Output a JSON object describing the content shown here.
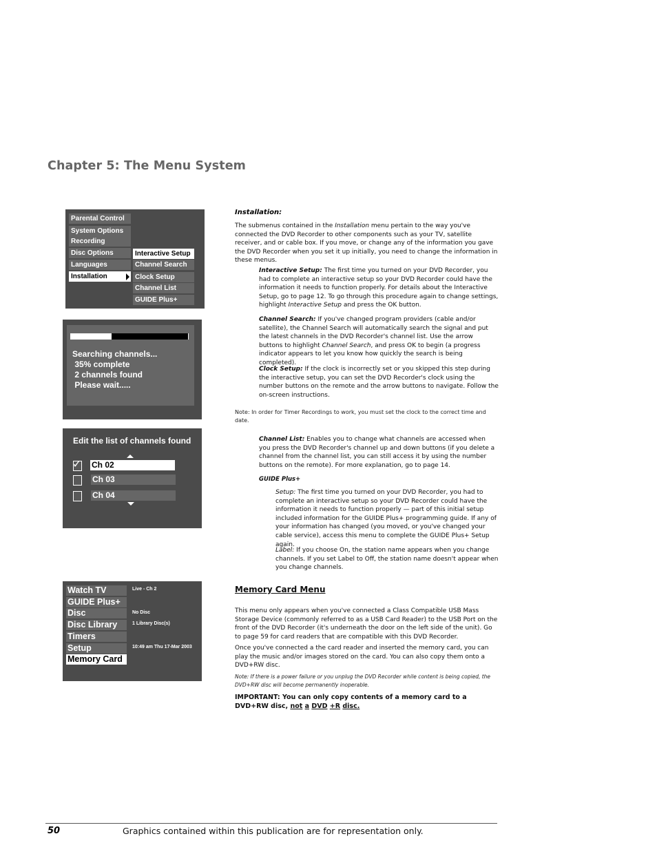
{
  "chapter_title": "Chapter 5: The Menu System",
  "setup_menu_screen": {
    "left_items": [
      {
        "label": "Parental Control",
        "selected": false
      },
      {
        "label": "System Options",
        "selected": false
      },
      {
        "label": "Recording Options",
        "selected": false
      },
      {
        "label": "Disc Options",
        "selected": false
      },
      {
        "label": "Languages",
        "selected": false
      },
      {
        "label": "Installation",
        "selected": true
      }
    ],
    "submenu_items": [
      {
        "label": "Interactive Setup",
        "selected": true
      },
      {
        "label": "Channel Search",
        "selected": false
      },
      {
        "label": "Clock Setup",
        "selected": false
      },
      {
        "label": "Channel List",
        "selected": false
      },
      {
        "label": "GUIDE Plus+",
        "selected": false
      }
    ]
  },
  "search_screen": {
    "progress_percent": 35,
    "lines": [
      "Searching channels...",
      " 35% complete",
      " 2 channels found",
      " Please wait....."
    ]
  },
  "edit_screen": {
    "title": "Edit the list of channels found",
    "channels": [
      {
        "label": "Ch 02",
        "checked": true,
        "selected": true
      },
      {
        "label": "Ch 03",
        "checked": false,
        "selected": false
      },
      {
        "label": "Ch 04",
        "checked": false,
        "selected": false
      }
    ]
  },
  "main_menu_screen": {
    "items": [
      {
        "label": "Watch TV",
        "info": "Live - Ch 2",
        "selected": false
      },
      {
        "label": "GUIDE Plus+",
        "info": "",
        "selected": false
      },
      {
        "label": "Disc",
        "info": "No Disc",
        "selected": false
      },
      {
        "label": "Disc Library",
        "info": "1 Library Disc(s)",
        "selected": false
      },
      {
        "label": "Timers",
        "info": "",
        "selected": false
      },
      {
        "label": "Setup",
        "info": "10:49 am Thu 17-Mar 2003",
        "selected": false
      },
      {
        "label": "Memory Card",
        "info": "",
        "selected": true
      }
    ]
  },
  "content": {
    "installation_heading": "Installation:",
    "installation_intro_a": " The submenus contained in the ",
    "installation_intro_em": "Installation",
    "installation_intro_b": " menu pertain to the way you've connected the DVD Recorder to other components such as your TV, satellite receiver, and or cable box. If you move, or change any of the information you gave the DVD Recorder when you set it up initially, you need to change the information in these menus.",
    "interactive_term": "Interactive Setup:",
    "interactive_a": " The first time you turned on your DVD Recorder, you had to complete an interactive setup so your DVD Recorder could have the information it needs to function properly. For details about the Interactive Setup, go to page 12. To go through this procedure again to change settings, highlight ",
    "interactive_em": "Interactive Setup",
    "interactive_b": " and press the OK button.",
    "search_term": "Channel Search:",
    "search_a": " If you've changed program providers (cable and/or satellite), the Channel Search will automatically search the signal and put the latest channels in the DVD Recorder's channel list. Use the arrow buttons to highlight ",
    "search_em": "Channel Search",
    "search_b": ", and press OK to begin (a progress indicator appears to let you know how quickly the search is being completed).",
    "clock_term": "Clock Setup:",
    "clock_text": " If the clock is incorrectly set or you skipped this step during the interactive setup, you can set the DVD Recorder's clock using the number buttons on the remote and the arrow buttons to navigate. Follow the on-screen instructions.",
    "clock_note": "Note: In order for Timer Recordings to work, you must set the clock to the correct time and date.",
    "list_term": "Channel List:",
    "list_text": " Enables you to change what channels are accessed when you press the DVD Recorder's channel up and down buttons (if you delete a channel from the channel list, you can still access it by using the number buttons on the remote). For more explanation, go to page 14.",
    "guide_heading": "GUIDE Plus+",
    "guide_setup_term": "Setup:",
    "guide_setup_text": " The first time you turned on your DVD Recorder, you had to complete an interactive setup so your DVD Recorder could have the information it needs to function properly — part of this initial setup included information for the GUIDE Plus+ programming guide. If any of your information has changed (you moved, or you've changed your cable service), access this menu to complete the GUIDE Plus+ Setup again.",
    "guide_label_term": "Label:",
    "guide_label_text": " If you choose On, the station name appears when you change channels. If you set Label to Off, the station name doesn't appear when you change channels.",
    "memory_heading": "Memory Card Menu",
    "memory_p1": "This menu only appears when you've connected a Class Compatible USB Mass Storage Device (commonly referred to as a USB Card Reader) to the USB Port on the front of the DVD Recorder (it's underneath the door on the left side of the unit). Go to page 59 for card readers that are compatible with this DVD Recorder.",
    "memory_p2": "Once you've connected a the card reader and inserted the memory card, you can play the music and/or images stored on the card. You can also copy them onto a DVD+RW disc.",
    "memory_note": "Note: If there is a power failure or you unplug the DVD Recorder while content is being copied, the DVD+RW disc will become permanently inoperable.",
    "important_a": "IMPORTANT: You can only copy contents of a memory card to a DVD+RW disc, ",
    "important_not": "not",
    "important_a2": "a",
    "important_dvd": "DVD",
    "important_r": "+R",
    "important_disc": "disc."
  },
  "footer": {
    "page_number": "50",
    "text": "Graphics contained within this publication are for representation only."
  }
}
